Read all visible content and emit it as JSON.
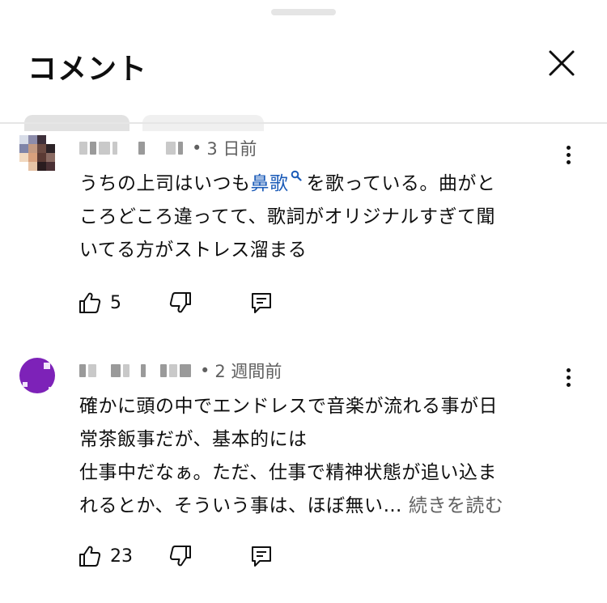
{
  "header": {
    "title": "コメント",
    "close_icon": "close-icon"
  },
  "comments": [
    {
      "timestamp": "3 日前",
      "text_before_link": "うちの上司はいつも",
      "link_text": "鼻歌",
      "text_after_link": "を歌っている。曲がと",
      "lines": [
        "ころどころ違ってて、歌詞がオリジナルすぎて聞",
        "いてる方がストレス溜まる"
      ],
      "likes": "5"
    },
    {
      "timestamp": "2 週間前",
      "lines": [
        "確かに頭の中でエンドレスで音楽が流れる事が日",
        "常茶飯事だが、基本的には",
        "仕事中だなぁ。ただ、仕事で精神状態が追い込ま"
      ],
      "last_line": "れるとか、そういう事は、ほぼ無い…",
      "more_label": "続きを読む",
      "likes": "23"
    }
  ],
  "colors": {
    "link": "#1b5bb8",
    "meta": "#606060",
    "avatar_purple": "#7d22b8"
  }
}
